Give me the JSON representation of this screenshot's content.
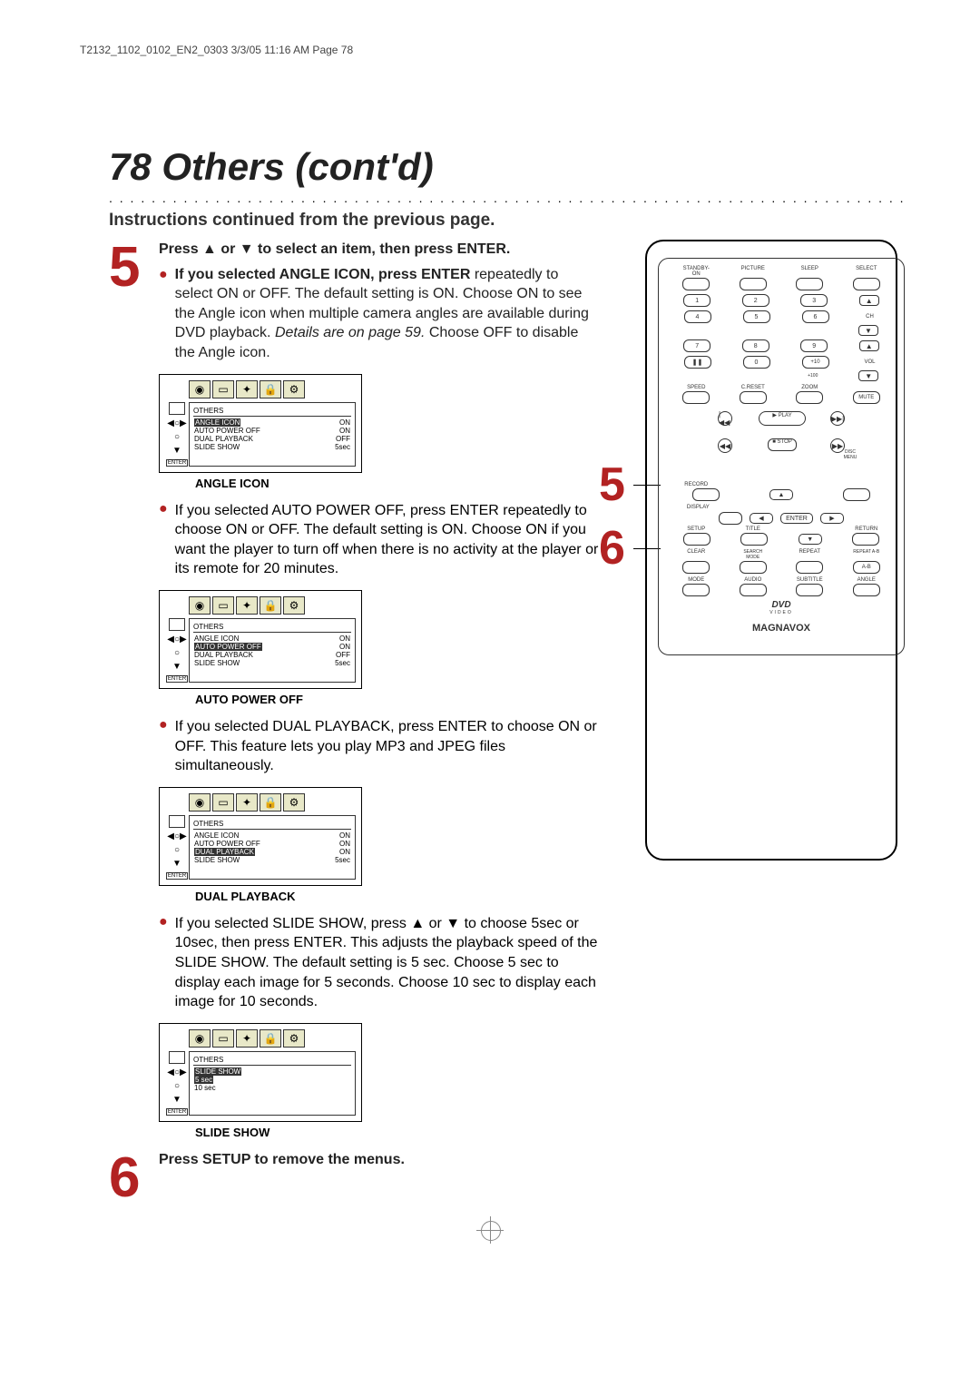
{
  "crop_header": "T2132_1102_0102_EN2_0303  3/3/05  11:16 AM  Page 78",
  "page_number": "78",
  "page_title": "Others (cont'd)",
  "subhead": "Instructions continued from the previous page.",
  "step5": {
    "num": "5",
    "head": "Press ▲ or ▼ to select an item, then press ENTER.",
    "angle": {
      "bold": "If you selected ANGLE ICON, press ENTER",
      "rest1": "repeatedly to select ON or OFF.  The default setting is ON. Choose ON to see the Angle icon when multiple camera angles are available during DVD playback. ",
      "italic": "Details are on page 59.",
      "rest2": " Choose OFF to disable the Angle icon.",
      "caption": "ANGLE ICON"
    },
    "auto": {
      "bold": "If you selected AUTO POWER OFF, press ENTER",
      "rest": "repeatedly to choose ON or OFF. The default setting is ON. Choose ON if you want the player to turn off when there is no activity at the player or its remote for 20 minutes.",
      "caption": "AUTO POWER OFF"
    },
    "dual": {
      "bold": "If you selected DUAL PLAYBACK, press ENTER to choose ON or OFF.  This feature lets you play MP3 and JPEG files simultaneously.",
      "caption": "DUAL PLAYBACK"
    },
    "slide": {
      "bold": "If you selected SLIDE SHOW, press ▲ or ▼ to choose 5sec or 10sec, then press ENTER.",
      "rest": " This adjusts the playback speed of the SLIDE SHOW. The default setting is 5 sec. Choose 5 sec to display each image for 5 seconds. Choose 10 sec to display each image for 10 seconds.",
      "caption": "SLIDE SHOW"
    }
  },
  "step6": {
    "num": "6",
    "text": "Press SETUP to remove the menus."
  },
  "osd": {
    "tab_title": "OTHERS",
    "rows": {
      "angle": {
        "k": "ANGLE ICON",
        "v": "ON"
      },
      "auto": {
        "k": "AUTO POWER OFF",
        "v": "ON"
      },
      "dual": {
        "k": "DUAL PLAYBACK",
        "v": "OFF"
      },
      "slide": {
        "k": "SLIDE SHOW",
        "v": "5sec"
      }
    },
    "slide_menu": {
      "title": "SLIDE SHOW",
      "opt1": "5 sec",
      "opt2": "10 sec"
    }
  },
  "remote": {
    "top_labels": {
      "a": "STANDBY-ON",
      "b": "PICTURE",
      "c": "SLEEP",
      "d": "SELECT"
    },
    "num": {
      "1": "1",
      "2": "2",
      "3": "3",
      "4": "4",
      "5": "5",
      "6": "6",
      "7": "7",
      "8": "8",
      "9": "9",
      "0": "0",
      "plus100": "+100",
      "plus10": "+10"
    },
    "ch": "CH",
    "vol": "VOL",
    "pause": "❚❚",
    "row2_labels": {
      "a": "SPEED",
      "b": "C.RESET",
      "c": "ZOOM",
      "d": "MUTE"
    },
    "transport": {
      "prev": "|◀◀",
      "play": "PLAY",
      "next": "▶▶|",
      "rew": "◀◀",
      "stop": "STOP",
      "ff": "▶▶",
      "disc": "DISC MENU"
    },
    "row3_labels": {
      "a": "RECORD",
      "b": "DISPLAY",
      "c": "SETUP",
      "d": "TITLE",
      "e": "RETURN",
      "f": "CLEAR",
      "g": "SEARCH MODE",
      "h": "REPEAT",
      "i": "REPEAT A-B",
      "j": "MODE",
      "k": "AUDIO",
      "l": "SUBTITLE",
      "m": "ANGLE"
    },
    "dpad": {
      "up": "▲",
      "down": "▼",
      "left": "◀",
      "right": "▶",
      "enter": "ENTER"
    },
    "dvd": "DVD",
    "video": "VIDEO",
    "brand": "MAGNAVOX"
  },
  "callouts": {
    "c5": "5",
    "c6": "6"
  }
}
